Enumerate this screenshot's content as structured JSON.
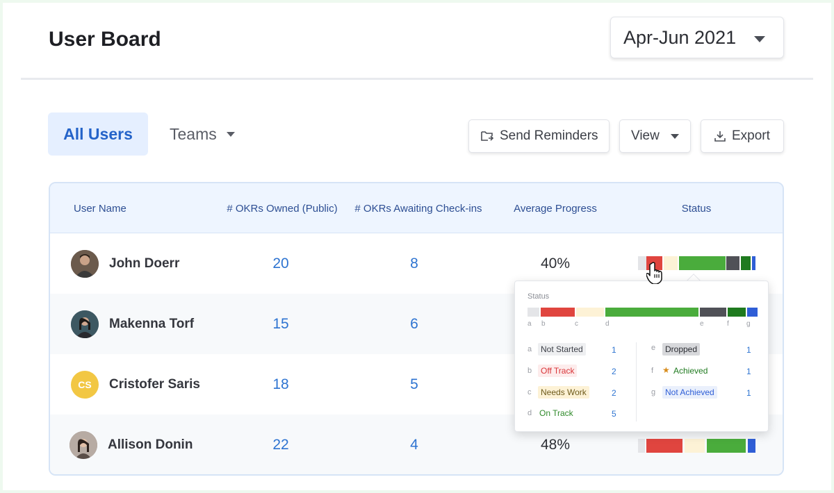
{
  "header": {
    "title": "User Board",
    "period": "Apr-Jun 2021"
  },
  "tabs": {
    "all_users": "All Users",
    "teams": "Teams"
  },
  "toolbar": {
    "send_reminders": "Send Reminders",
    "view": "View",
    "export": "Export"
  },
  "table": {
    "columns": {
      "user_name": "User Name",
      "okrs_owned": "# OKRs Owned (Public)",
      "okrs_awaiting": "# OKRs Awaiting Check-ins",
      "avg_progress": "Average Progress",
      "status": "Status"
    },
    "rows": [
      {
        "name": "John Doerr",
        "okrs_owned": "20",
        "okrs_awaiting": "8",
        "avg_progress": "40%",
        "avatar_initials": "",
        "avatar_color": "#5a4a3e"
      },
      {
        "name": "Makenna Torf",
        "okrs_owned": "15",
        "okrs_awaiting": "6",
        "avg_progress": "",
        "avatar_initials": "",
        "avatar_color": "#3a5560"
      },
      {
        "name": "Cristofer Saris",
        "okrs_owned": "18",
        "okrs_awaiting": "5",
        "avg_progress": "",
        "avatar_initials": "CS",
        "avatar_color": "#f2c744"
      },
      {
        "name": "Allison Donin",
        "okrs_owned": "22",
        "okrs_awaiting": "4",
        "avg_progress": "48%",
        "avatar_initials": "",
        "avatar_color": "#8a7d76"
      }
    ]
  },
  "status_colors": {
    "not_started": "#e4e5e8",
    "off_track": "#e0453f",
    "needs_work": "#fdf2d6",
    "on_track": "#4aac3c",
    "dropped": "#505157",
    "achieved": "#1f7a1f",
    "not_achieved": "#2f5ed6"
  },
  "status_popover": {
    "title": "Status",
    "letters": [
      "a",
      "b",
      "c",
      "d",
      "e",
      "f",
      "g"
    ],
    "legend": [
      {
        "letter": "a",
        "label": "Not Started",
        "count": "1"
      },
      {
        "letter": "b",
        "label": "Off Track",
        "count": "2"
      },
      {
        "letter": "c",
        "label": "Needs Work",
        "count": "2"
      },
      {
        "letter": "d",
        "label": "On Track",
        "count": "5"
      },
      {
        "letter": "e",
        "label": "Dropped",
        "count": "1"
      },
      {
        "letter": "f",
        "label": "Achieved",
        "count": "1",
        "icon": "party-popper-icon"
      },
      {
        "letter": "g",
        "label": "Not Achieved",
        "count": "1"
      }
    ]
  }
}
